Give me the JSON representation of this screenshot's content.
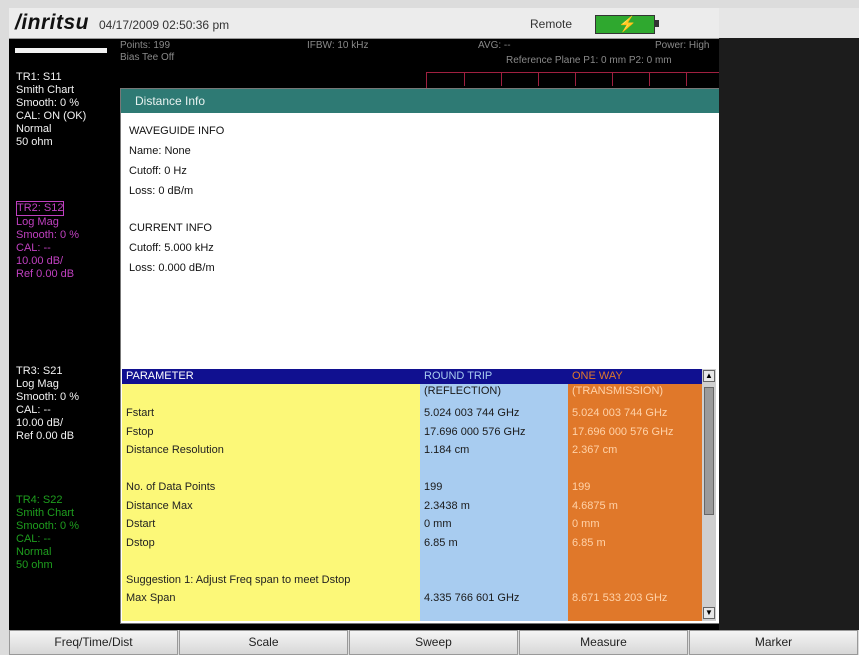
{
  "header": {
    "brand": "/inritsu",
    "datetime": "04/17/2009 02:50:36 pm",
    "remote_label": "Remote"
  },
  "status": {
    "points": "Points: 199",
    "bias_tee": "Bias Tee Off",
    "ifbw": "IFBW: 10 kHz",
    "avg": "AVG: --",
    "power": "Power: High",
    "ref_plane": "Reference Plane P1: 0 mm P2: 0 mm"
  },
  "traces": [
    {
      "lines": [
        "TR1: S11",
        "Smith Chart",
        "Smooth: 0 %",
        "CAL: ON (OK)",
        "Normal",
        "50 ohm"
      ]
    },
    {
      "lines": [
        "TR2: S12",
        "Log Mag",
        "Smooth: 0 %",
        "CAL: --",
        "10.00 dB/",
        "Ref 0.00 dB"
      ]
    },
    {
      "lines": [
        "TR3: S21",
        "Log Mag",
        "Smooth: 0 %",
        "CAL: --",
        "10.00 dB/",
        "Ref 0.00 dB"
      ]
    },
    {
      "lines": [
        "TR4: S22",
        "Smith Chart",
        "Smooth: 0 %",
        "CAL: --",
        "Normal",
        "50 ohm"
      ]
    }
  ],
  "dialog": {
    "title": "Distance Info",
    "waveguide_header": "WAVEGUIDE INFO",
    "waveguide_name": "Name: None",
    "waveguide_cutoff": "Cutoff: 0 Hz",
    "waveguide_loss": "Loss: 0 dB/m",
    "current_header": "CURRENT INFO",
    "current_cutoff": "Cutoff: 5.000 kHz",
    "current_loss": "Loss: 0.000 dB/m",
    "table": {
      "headers": [
        "PARAMETER",
        "ROUND TRIP",
        "ONE WAY"
      ],
      "subheaders": [
        "",
        "(REFLECTION)",
        "(TRANSMISSION)"
      ],
      "rows": [
        [
          "Fstart",
          "5.024 003 744 GHz",
          "5.024 003 744 GHz"
        ],
        [
          "Fstop",
          "17.696 000 576 GHz",
          "17.696 000 576 GHz"
        ],
        [
          "Distance Resolution",
          "1.184 cm",
          "2.367 cm"
        ],
        [
          "",
          "",
          ""
        ],
        [
          "No. of Data Points",
          "199",
          "199"
        ],
        [
          "Distance Max",
          "2.3438 m",
          "4.6875 m"
        ],
        [
          "Dstart",
          "0 mm",
          "0 mm"
        ],
        [
          "Dstop",
          "6.85 m",
          "6.85 m"
        ],
        [
          "",
          "",
          ""
        ],
        [
          "Suggestion 1: Adjust Freq span to meet Dstop",
          "",
          ""
        ],
        [
          "Max Span",
          "4.335 766 601 GHz",
          "8.671 533 203 GHz"
        ]
      ]
    }
  },
  "softkeys": [
    "Freq/Time/Dist",
    "Scale",
    "Sweep",
    "Measure",
    "Marker"
  ],
  "colors": {
    "dialog_title_bg": "#2e7a74",
    "param_col": "#fcf878",
    "round_trip_col": "#a8ccf0",
    "one_way_col": "#e0782a",
    "header_bg": "#101090"
  }
}
